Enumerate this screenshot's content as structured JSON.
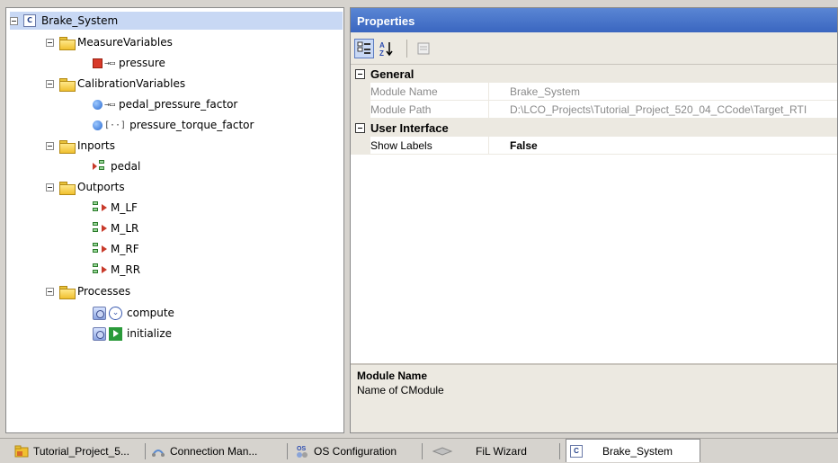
{
  "tree": {
    "root": {
      "label": "Brake_System",
      "icon_text": "C"
    },
    "nodes": [
      {
        "label": "MeasureVariables",
        "type": "folder"
      },
      {
        "label": "pressure",
        "type": "measure",
        "glyph": "→▭"
      },
      {
        "label": "CalibrationVariables",
        "type": "folder"
      },
      {
        "label": "pedal_pressure_factor",
        "type": "calibration",
        "glyph": "→▭"
      },
      {
        "label": "pressure_torque_factor",
        "type": "calibration",
        "glyph": "[··]"
      },
      {
        "label": "Inports",
        "type": "folder"
      },
      {
        "label": "pedal",
        "type": "inport"
      },
      {
        "label": "Outports",
        "type": "folder"
      },
      {
        "label": "M_LF",
        "type": "outport"
      },
      {
        "label": "M_LR",
        "type": "outport"
      },
      {
        "label": "M_RF",
        "type": "outport"
      },
      {
        "label": "M_RR",
        "type": "outport"
      },
      {
        "label": "Processes",
        "type": "folder"
      },
      {
        "label": "compute",
        "type": "process"
      },
      {
        "label": "initialize",
        "type": "process"
      }
    ]
  },
  "properties": {
    "title": "Properties",
    "toolbar": {
      "categorized_icon": "categorized-view-icon",
      "alphabetical_icon": "sort-alphabetical-icon",
      "pages_icon": "property-pages-icon",
      "az_text": "A\nZ"
    },
    "categories": [
      {
        "name": "General",
        "rows": [
          {
            "name": "Module Name",
            "value": "Brake_System"
          },
          {
            "name": "Module Path",
            "value": "D:\\LCO_Projects\\Tutorial_Project_520_04_CCode\\Target_RTI"
          }
        ]
      },
      {
        "name": "User Interface",
        "rows": [
          {
            "name": "Show Labels",
            "value": "False"
          }
        ]
      }
    ],
    "description": {
      "title": "Module Name",
      "text": "Name of CModule"
    }
  },
  "taskbar": {
    "tabs": [
      {
        "label": "Tutorial_Project_5...",
        "icon": "project-folder-icon"
      },
      {
        "label": "Connection Man...",
        "icon": "connection-manager-icon"
      },
      {
        "label": "OS Configuration",
        "icon": "os-configuration-icon"
      },
      {
        "label": "FiL Wizard",
        "icon": "fil-wizard-icon"
      },
      {
        "label": "Brake_System",
        "icon": "cmodule-icon",
        "icon_text": "C"
      }
    ]
  },
  "colors": {
    "header_blue": "#3a66c0",
    "selection": "#c8d8f4",
    "panel_gray": "#ece9e1",
    "window_bg": "#d6d3ce"
  }
}
